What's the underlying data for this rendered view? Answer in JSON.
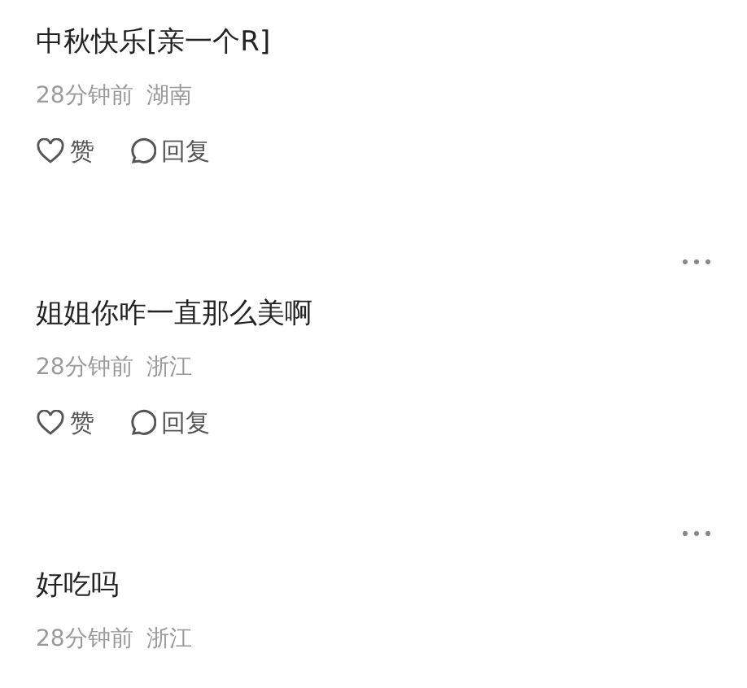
{
  "comments": [
    {
      "show_menu": false,
      "text": "中秋快乐[亲一个R]",
      "time": "28分钟前",
      "location": "湖南",
      "actions": [
        {
          "kind": "like",
          "label": "赞"
        },
        {
          "kind": "reply",
          "label": "回复"
        }
      ]
    },
    {
      "show_menu": true,
      "text": "姐姐你咋一直那么美啊",
      "time": "28分钟前",
      "location": "浙江",
      "actions": [
        {
          "kind": "like",
          "label": "赞"
        },
        {
          "kind": "reply",
          "label": "回复"
        }
      ]
    },
    {
      "show_menu": true,
      "text": "好吃吗",
      "time": "28分钟前",
      "location": "浙江"
    }
  ]
}
